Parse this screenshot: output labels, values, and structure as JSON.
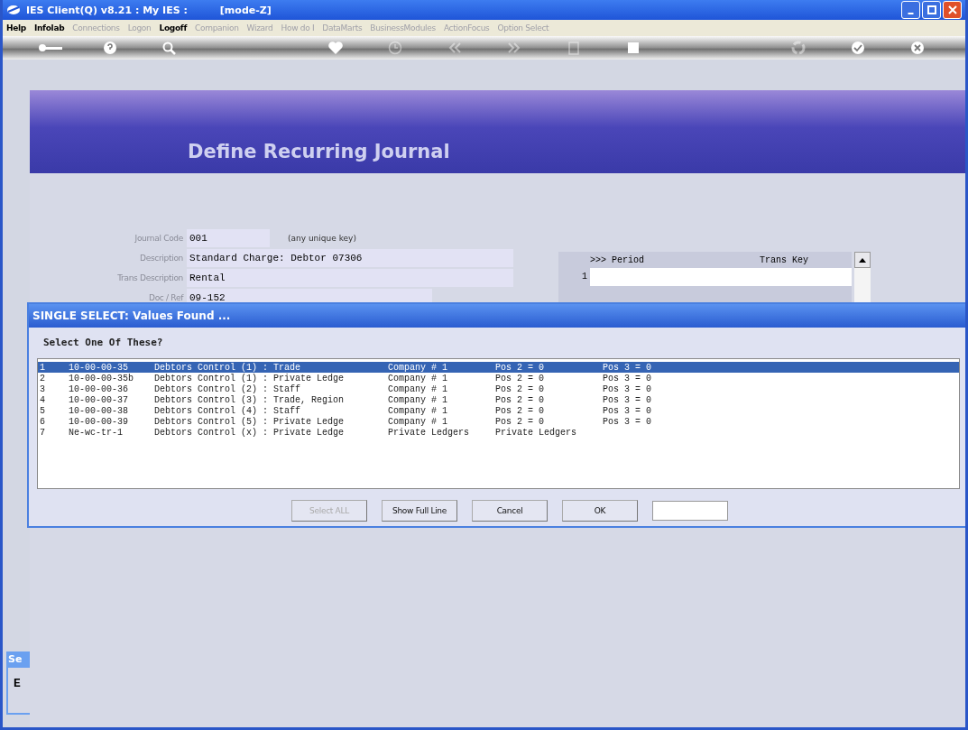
{
  "window": {
    "title": "IES Client(Q) v8.21 : My IES :",
    "mode": "[mode-Z]"
  },
  "menu": [
    {
      "label": "Help",
      "disabled": false
    },
    {
      "label": "Infolab",
      "disabled": false
    },
    {
      "label": "Connections",
      "disabled": true
    },
    {
      "label": "Logon",
      "disabled": true
    },
    {
      "label": "Logoff",
      "disabled": false
    },
    {
      "label": "Companion",
      "disabled": true
    },
    {
      "label": "Wizard",
      "disabled": true
    },
    {
      "label": "How do I",
      "disabled": true
    },
    {
      "label": "DataMarts",
      "disabled": true
    },
    {
      "label": "BusinessModules",
      "disabled": true
    },
    {
      "label": "ActionFocus",
      "disabled": true
    },
    {
      "label": "Option Select",
      "disabled": true
    }
  ],
  "toolbar": [
    {
      "kind": "key",
      "disabled": false
    },
    {
      "kind": "help",
      "disabled": false
    },
    {
      "kind": "search",
      "disabled": false
    },
    {
      "kind": "gap"
    },
    {
      "kind": "heart",
      "disabled": false
    },
    {
      "kind": "clock",
      "disabled": true
    },
    {
      "kind": "back",
      "disabled": true
    },
    {
      "kind": "forward",
      "disabled": true
    },
    {
      "kind": "document",
      "disabled": true
    },
    {
      "kind": "stop",
      "disabled": false
    },
    {
      "kind": "gap"
    },
    {
      "kind": "recycle",
      "disabled": true
    },
    {
      "kind": "check",
      "disabled": false
    },
    {
      "kind": "close",
      "disabled": false
    }
  ],
  "page": {
    "title": "Define Recurring Journal"
  },
  "form": {
    "fields": [
      {
        "label": "Journal Code",
        "value": "001",
        "hint": "(any unique key)"
      },
      {
        "label": "Description",
        "value": "Standard Charge: Debtor 07306"
      },
      {
        "label": "Trans Description",
        "value": "Rental"
      },
      {
        "label": "Doc / Ref",
        "value": "09-152"
      }
    ]
  },
  "period_table": {
    "columns": [
      ">>> Period",
      "Trans Key"
    ],
    "rows": [
      "1"
    ]
  },
  "dialog": {
    "title": "SINGLE SELECT: Values Found ...",
    "prompt": "Select One Of These?",
    "rows": [
      {
        "cells": [
          "1",
          "10-00-00-35",
          "Debtors Control (1) : Trade",
          "Company # 1",
          "Pos 2 = 0",
          "Pos 3 = 0"
        ],
        "selected": true
      },
      {
        "cells": [
          "2",
          "10-00-00-35b",
          "Debtors Control (1) : Private Ledge",
          "Company # 1",
          "Pos 2 = 0",
          "Pos 3 = 0"
        ],
        "selected": false
      },
      {
        "cells": [
          "3",
          "10-00-00-36",
          "Debtors Control (2) : Staff",
          "Company # 1",
          "Pos 2 = 0",
          "Pos 3 = 0"
        ],
        "selected": false
      },
      {
        "cells": [
          "4",
          "10-00-00-37",
          "Debtors Control (3) : Trade, Region",
          "Company # 1",
          "Pos 2 = 0",
          "Pos 3 = 0"
        ],
        "selected": false
      },
      {
        "cells": [
          "5",
          "10-00-00-38",
          "Debtors Control (4) : Staff",
          "Company # 1",
          "Pos 2 = 0",
          "Pos 3 = 0"
        ],
        "selected": false
      },
      {
        "cells": [
          "6",
          "10-00-00-39",
          "Debtors Control (5) : Private Ledge",
          "Company # 1",
          "Pos 2 = 0",
          "Pos 3 = 0"
        ],
        "selected": false
      },
      {
        "cells": [
          "7",
          "Ne-wc-tr-1",
          "Debtors Control (x) : Private Ledge",
          "Private Ledgers",
          "Private Ledgers"
        ],
        "selected": false
      }
    ],
    "buttons": [
      {
        "label": "Select ALL",
        "disabled": true
      },
      {
        "label": "Show Full Line",
        "disabled": false
      },
      {
        "label": "Cancel",
        "disabled": false
      },
      {
        "label": "OK",
        "disabled": false
      }
    ]
  },
  "background_window": {
    "title": "Se",
    "text": "E"
  }
}
